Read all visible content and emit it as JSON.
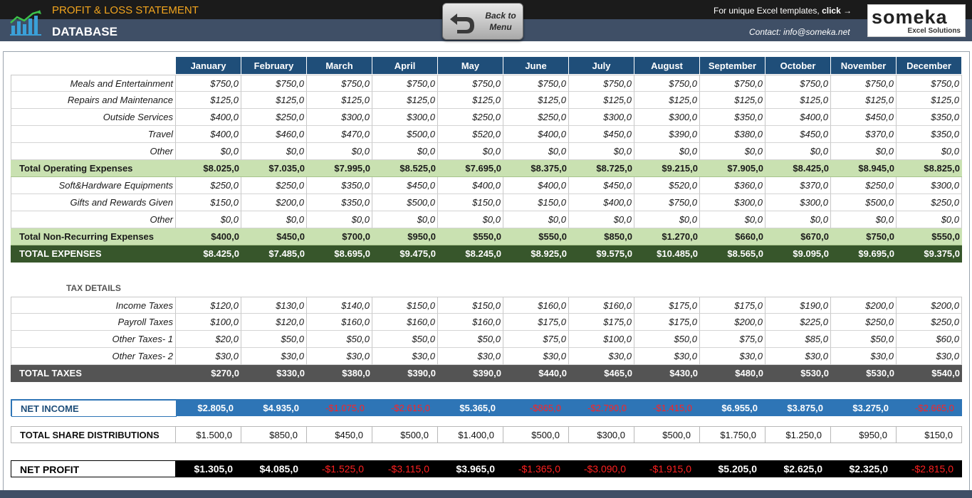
{
  "header": {
    "subtitle": "PROFIT & LOSS STATEMENT",
    "title": "DATABASE",
    "back_button_label": "Back to Menu",
    "promo_text": "For unique Excel templates,",
    "promo_link": "click →",
    "contact": "Contact: info@someka.net",
    "brand_name": "someka",
    "brand_tagline": "Excel Solutions"
  },
  "months": [
    "January",
    "February",
    "March",
    "April",
    "May",
    "June",
    "July",
    "August",
    "September",
    "October",
    "November",
    "December"
  ],
  "rows": {
    "meals": {
      "label": "Meals and Entertainment",
      "values": [
        "$750,0",
        "$750,0",
        "$750,0",
        "$750,0",
        "$750,0",
        "$750,0",
        "$750,0",
        "$750,0",
        "$750,0",
        "$750,0",
        "$750,0",
        "$750,0"
      ]
    },
    "repairs": {
      "label": "Repairs and Maintenance",
      "values": [
        "$125,0",
        "$125,0",
        "$125,0",
        "$125,0",
        "$125,0",
        "$125,0",
        "$125,0",
        "$125,0",
        "$125,0",
        "$125,0",
        "$125,0",
        "$125,0"
      ]
    },
    "outside": {
      "label": "Outside Services",
      "values": [
        "$400,0",
        "$250,0",
        "$300,0",
        "$300,0",
        "$250,0",
        "$250,0",
        "$300,0",
        "$300,0",
        "$350,0",
        "$400,0",
        "$450,0",
        "$350,0"
      ]
    },
    "travel": {
      "label": "Travel",
      "values": [
        "$400,0",
        "$460,0",
        "$470,0",
        "$500,0",
        "$520,0",
        "$400,0",
        "$450,0",
        "$390,0",
        "$380,0",
        "$450,0",
        "$370,0",
        "$350,0"
      ]
    },
    "other1": {
      "label": "Other",
      "values": [
        "$0,0",
        "$0,0",
        "$0,0",
        "$0,0",
        "$0,0",
        "$0,0",
        "$0,0",
        "$0,0",
        "$0,0",
        "$0,0",
        "$0,0",
        "$0,0"
      ]
    },
    "total_operating": {
      "label": "Total Operating Expenses",
      "values": [
        "$8.025,0",
        "$7.035,0",
        "$7.995,0",
        "$8.525,0",
        "$7.695,0",
        "$8.375,0",
        "$8.725,0",
        "$9.215,0",
        "$7.905,0",
        "$8.425,0",
        "$8.945,0",
        "$8.825,0"
      ]
    },
    "software": {
      "label": "Soft&Hardware Equipments",
      "values": [
        "$250,0",
        "$250,0",
        "$350,0",
        "$450,0",
        "$400,0",
        "$400,0",
        "$450,0",
        "$520,0",
        "$360,0",
        "$370,0",
        "$250,0",
        "$300,0"
      ]
    },
    "gifts": {
      "label": "Gifts and Rewards Given",
      "values": [
        "$150,0",
        "$200,0",
        "$350,0",
        "$500,0",
        "$150,0",
        "$150,0",
        "$400,0",
        "$750,0",
        "$300,0",
        "$300,0",
        "$500,0",
        "$250,0"
      ]
    },
    "other2": {
      "label": "Other",
      "values": [
        "$0,0",
        "$0,0",
        "$0,0",
        "$0,0",
        "$0,0",
        "$0,0",
        "$0,0",
        "$0,0",
        "$0,0",
        "$0,0",
        "$0,0",
        "$0,0"
      ]
    },
    "total_nonrecurring": {
      "label": "Total Non-Recurring Expenses",
      "values": [
        "$400,0",
        "$450,0",
        "$700,0",
        "$950,0",
        "$550,0",
        "$550,0",
        "$850,0",
        "$1.270,0",
        "$660,0",
        "$670,0",
        "$750,0",
        "$550,0"
      ]
    },
    "total_expenses": {
      "label": "TOTAL EXPENSES",
      "values": [
        "$8.425,0",
        "$7.485,0",
        "$8.695,0",
        "$9.475,0",
        "$8.245,0",
        "$8.925,0",
        "$9.575,0",
        "$10.485,0",
        "$8.565,0",
        "$9.095,0",
        "$9.695,0",
        "$9.375,0"
      ]
    },
    "income_taxes": {
      "label": "Income Taxes",
      "values": [
        "$120,0",
        "$130,0",
        "$140,0",
        "$150,0",
        "$150,0",
        "$160,0",
        "$160,0",
        "$175,0",
        "$175,0",
        "$190,0",
        "$200,0",
        "$200,0"
      ]
    },
    "payroll_taxes": {
      "label": "Payroll Taxes",
      "values": [
        "$100,0",
        "$120,0",
        "$160,0",
        "$160,0",
        "$160,0",
        "$175,0",
        "$175,0",
        "$175,0",
        "$200,0",
        "$225,0",
        "$250,0",
        "$250,0"
      ]
    },
    "other_taxes1": {
      "label": "Other Taxes- 1",
      "values": [
        "$20,0",
        "$50,0",
        "$50,0",
        "$50,0",
        "$50,0",
        "$75,0",
        "$100,0",
        "$50,0",
        "$75,0",
        "$85,0",
        "$50,0",
        "$60,0"
      ]
    },
    "other_taxes2": {
      "label": "Other Taxes- 2",
      "values": [
        "$30,0",
        "$30,0",
        "$30,0",
        "$30,0",
        "$30,0",
        "$30,0",
        "$30,0",
        "$30,0",
        "$30,0",
        "$30,0",
        "$30,0",
        "$30,0"
      ]
    },
    "total_taxes": {
      "label": "TOTAL TAXES",
      "values": [
        "$270,0",
        "$330,0",
        "$380,0",
        "$390,0",
        "$390,0",
        "$440,0",
        "$465,0",
        "$430,0",
        "$480,0",
        "$530,0",
        "$530,0",
        "$540,0"
      ]
    },
    "net_income": {
      "label": "NET INCOME",
      "values": [
        "$2.805,0",
        "$4.935,0",
        "-$1.075,0",
        "-$2.615,0",
        "$5.365,0",
        "-$865,0",
        "-$2.790,0",
        "-$1.415,0",
        "$6.955,0",
        "$3.875,0",
        "$3.275,0",
        "-$2.665,0"
      ]
    },
    "share_dist": {
      "label": "TOTAL SHARE DISTRIBUTIONS",
      "values": [
        "$1.500,0",
        "$850,0",
        "$450,0",
        "$500,0",
        "$1.400,0",
        "$500,0",
        "$300,0",
        "$500,0",
        "$1.750,0",
        "$1.250,0",
        "$950,0",
        "$150,0"
      ]
    },
    "net_profit": {
      "label": "NET PROFIT",
      "values": [
        "$1.305,0",
        "$4.085,0",
        "-$1.525,0",
        "-$3.115,0",
        "$3.965,0",
        "-$1.365,0",
        "-$3.090,0",
        "-$1.915,0",
        "$5.205,0",
        "$2.625,0",
        "$2.325,0",
        "-$2.815,0"
      ]
    }
  },
  "tax_section_label": "TAX DETAILS",
  "colors": {
    "header_dark": "#1b1b1b",
    "header_blue": "#3f4f66",
    "accent_orange": "#f2a51e",
    "month_header": "#1f4e79",
    "subtotal_green": "#c9e1b1",
    "total_dark_green": "#37562b",
    "total_gray": "#545454",
    "net_income_blue": "#2e75b6",
    "negative_red": "#ff2222"
  }
}
